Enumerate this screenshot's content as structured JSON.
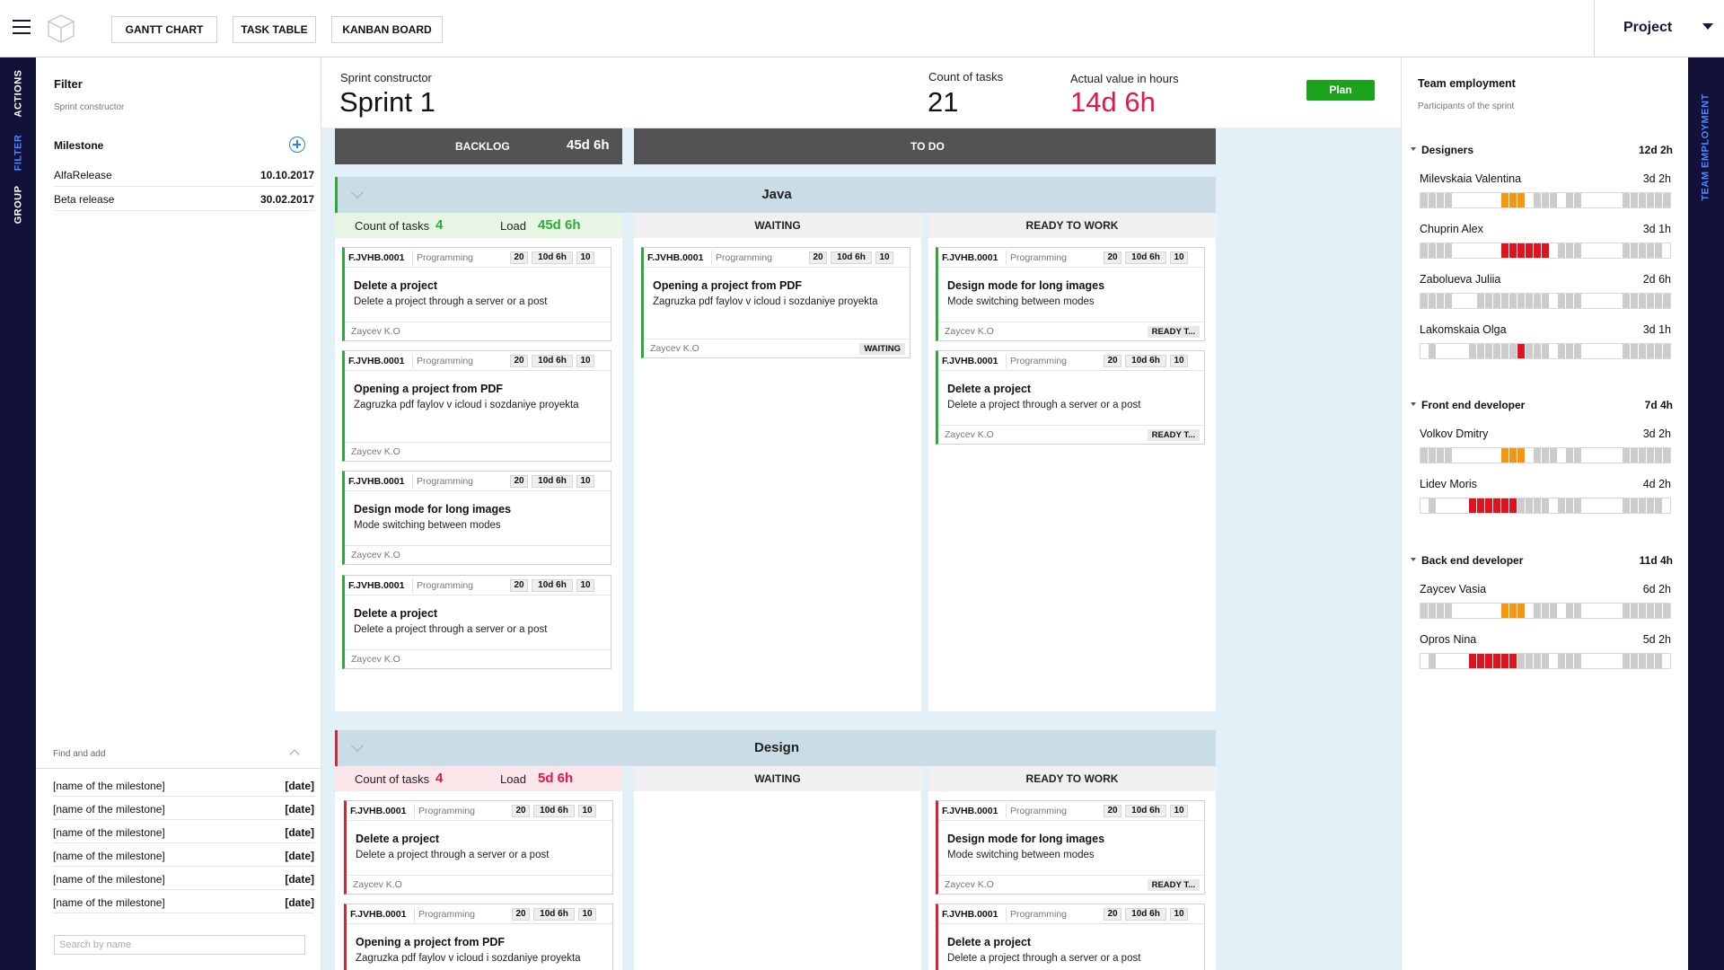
{
  "topbar": {
    "menu_icon": "hamburger-icon",
    "logo_icon": "cube-logo-icon",
    "views": [
      "GANTT CHART",
      "TASK TABLE",
      "KANBAN BOARD"
    ],
    "project_label": "Project",
    "project_caret_icon": "caret-down-icon"
  },
  "left_rail": {
    "tabs": [
      {
        "label": "ACTIONS",
        "active": false
      },
      {
        "label": "FILTER",
        "active": true
      },
      {
        "label": "GROUP",
        "active": false
      }
    ]
  },
  "filter": {
    "title": "Filter",
    "subtitle": "Sprint constructor",
    "milestone_label": "Milestone",
    "add_icon": "plus-circle-icon",
    "milestones": [
      {
        "name": "AlfaRelease",
        "date": "10.10.2017"
      },
      {
        "name": "Beta release",
        "date": "30.02.2017"
      }
    ],
    "find_and_add": {
      "label": "Find and add",
      "collapse_icon": "chevron-up-icon",
      "items": [
        {
          "name": "[name of the milestone]",
          "date": "[date]"
        },
        {
          "name": "[name of the milestone]",
          "date": "[date]"
        },
        {
          "name": "[name of the milestone]",
          "date": "[date]"
        },
        {
          "name": "[name of the milestone]",
          "date": "[date]"
        },
        {
          "name": "[name of the milestone]",
          "date": "[date]"
        },
        {
          "name": "[name of the milestone]",
          "date": "[date]"
        }
      ],
      "search_placeholder": "Search by name"
    }
  },
  "sprint": {
    "constructor_label": "Sprint constructor",
    "name": "Sprint 1",
    "count_label": "Count of tasks",
    "count": "21",
    "actual_label": "Actual value in hours",
    "actual": "14d 6h",
    "plan_button": "Plan"
  },
  "columns": {
    "backlog_label": "BACKLOG",
    "backlog_value": "45d 6h",
    "todo_label": "TO DO"
  },
  "groups": [
    {
      "name": "Java",
      "accent": "#2eaa3a",
      "count_label": "Count of tasks",
      "count": "4",
      "load_label": "Load",
      "load": "45d 6h",
      "waiting_label": "WAITING",
      "ready_label": "READY TO WORK",
      "backlog_cards": [
        {
          "id": "F.JVHB.0001",
          "category": "Programming",
          "points": "20",
          "duration": "10d 6h",
          "num": "10",
          "title": "Delete a project",
          "desc": "Delete a project through a server or a post",
          "assignee": "Zaycev K.O"
        },
        {
          "id": "F.JVHB.0001",
          "category": "Programming",
          "points": "20",
          "duration": "10d 6h",
          "num": "10",
          "title": "Opening a project from PDF",
          "desc": "Zagruzka pdf faylov v icloud i sozdaniye proyekta",
          "assignee": "Zaycev K.O"
        },
        {
          "id": "F.JVHB.0001",
          "category": "Programming",
          "points": "20",
          "duration": "10d 6h",
          "num": "10",
          "title": "Design mode for long images",
          "desc": "Mode switching between modes",
          "assignee": "Zaycev K.O"
        },
        {
          "id": "F.JVHB.0001",
          "category": "Programming",
          "points": "20",
          "duration": "10d 6h",
          "num": "10",
          "title": "Delete a project",
          "desc": "Delete a project through a server or a post",
          "assignee": "Zaycev K.O"
        }
      ],
      "waiting_cards": [
        {
          "id": "F.JVHB.0001",
          "category": "Programming",
          "points": "20",
          "duration": "10d 6h",
          "num": "10",
          "title": "Opening a project from PDF",
          "desc": "Zagruzka pdf faylov v icloud i sozdaniye proyekta",
          "assignee": "Zaycev K.O",
          "status": "WAITING"
        }
      ],
      "ready_cards": [
        {
          "id": "F.JVHB.0001",
          "category": "Programming",
          "points": "20",
          "duration": "10d 6h",
          "num": "10",
          "title": "Design mode for long images",
          "desc": "Mode switching between modes",
          "assignee": "Zaycev K.O",
          "status": "READY T..."
        },
        {
          "id": "F.JVHB.0001",
          "category": "Programming",
          "points": "20",
          "duration": "10d 6h",
          "num": "10",
          "title": "Delete a project",
          "desc": "Delete a project through a server or a post",
          "assignee": "Zaycev K.O",
          "status": "READY T..."
        }
      ]
    },
    {
      "name": "Design",
      "accent": "#d8243a",
      "count_label": "Count of tasks",
      "count": "4",
      "load_label": "Load",
      "load": "5d 6h",
      "waiting_label": "WAITING",
      "ready_label": "READY TO WORK",
      "backlog_cards": [
        {
          "id": "F.JVHB.0001",
          "category": "Programming",
          "points": "20",
          "duration": "10d 6h",
          "num": "10",
          "title": "Delete a project",
          "desc": "Delete a project through a server or a post",
          "assignee": "Zaycev K.O"
        },
        {
          "id": "F.JVHB.0001",
          "category": "Programming",
          "points": "20",
          "duration": "10d 6h",
          "num": "10",
          "title": "Opening a project from PDF",
          "desc": "Zagruzka pdf faylov v icloud i sozdaniye proyekta",
          "assignee": ""
        }
      ],
      "ready_cards": [
        {
          "id": "F.JVHB.0001",
          "category": "Programming",
          "points": "20",
          "duration": "10d 6h",
          "num": "10",
          "title": "Design mode for long images",
          "desc": "Mode switching between modes",
          "assignee": "Zaycev K.O",
          "status": "READY T..."
        },
        {
          "id": "F.JVHB.0001",
          "category": "Programming",
          "points": "20",
          "duration": "10d 6h",
          "num": "10",
          "title": "Delete a project",
          "desc": "Delete a project through a server or a post",
          "assignee": ""
        }
      ]
    }
  ],
  "team": {
    "title": "Team employment",
    "subtitle": "Participants of the sprint",
    "tab_label": "TEAM EMPLOYMENT",
    "colors": {
      "free": "#ffffff",
      "busy": "#cccccc",
      "medium": "#f5960f",
      "over": "#e0121e"
    },
    "groups": [
      {
        "name": "Designers",
        "total": "12d 2h",
        "members": [
          {
            "name": "Milevskaia Valentina",
            "value": "3d 2h",
            "load": "gbggwwwwwwooowgbbwgbwwwwwbbbbbb"
          },
          {
            "name": "Chuprin Alex",
            "value": "3d 1h",
            "load": "gbggwwwwwwrrrrrrwgbbwwwwwbbbbbw"
          },
          {
            "name": "Zabolueva Juliia",
            "value": "2d 6h",
            "load": "gbggwwwbbbbbbbbbwgbbwwwwwbbbbbb"
          },
          {
            "name": "Lakomskaia Olga",
            "value": "3d 1h",
            "load": "wbwwwwbbbbbbrbbbwgbbwwwwwbbbbbb"
          }
        ]
      },
      {
        "name": "Front end developer",
        "total": "7d 4h",
        "members": [
          {
            "name": "Volkov Dmitry",
            "value": "3d 2h",
            "load": "gbggwwwwwwooowgbbwgbwwwwwbbbbbb"
          },
          {
            "name": "Lidev Moris",
            "value": "4d 2h",
            "load": "wbwwwwrrrrrrbbbbwgbbwwwwwbbbbbw"
          }
        ]
      },
      {
        "name": "Back end developer",
        "total": "11d 4h",
        "members": [
          {
            "name": "Zaycev Vasia",
            "value": "6d 2h",
            "load": "gbggwwwwwwooowgbbwgbwwwwwbbbbbb"
          },
          {
            "name": "Opros Nina",
            "value": "5d 2h",
            "load": "wbwwwwrrrrrrbbbbwgbbwwwwwbbbbbw"
          }
        ]
      }
    ]
  }
}
